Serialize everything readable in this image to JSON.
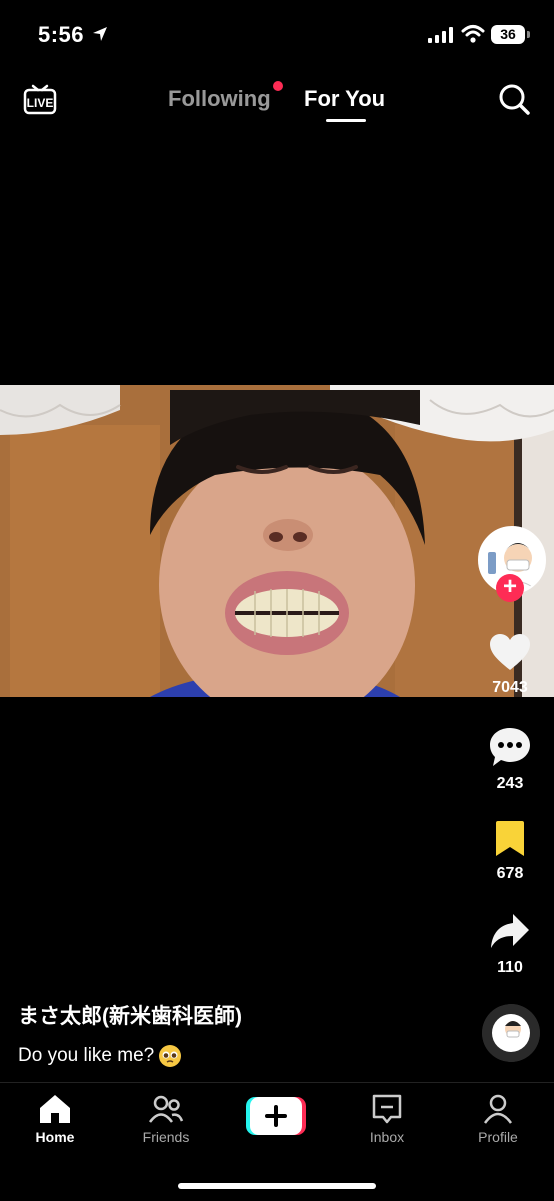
{
  "status_bar": {
    "time": "5:56",
    "battery": "36"
  },
  "top_nav": {
    "live_label": "LIVE",
    "tab_following": "Following",
    "tab_for_you": "For You",
    "active_tab": "For You"
  },
  "video": {
    "creator_name": "まさ太郎(新米歯科医師)",
    "caption": "Do you like me?"
  },
  "actions": {
    "likes": "7043",
    "comments": "243",
    "saves": "678",
    "shares": "110"
  },
  "bottom_nav": {
    "home": "Home",
    "friends": "Friends",
    "inbox": "Inbox",
    "profile": "Profile",
    "active": "Home"
  },
  "colors": {
    "accent": "#fe2c55",
    "bookmark": "#f9d338",
    "background": "#000000"
  },
  "icons": [
    "location-arrow-icon",
    "signal-icon",
    "wifi-icon",
    "battery-icon",
    "live-icon",
    "search-icon",
    "heart-icon",
    "comment-icon",
    "bookmark-icon",
    "share-icon",
    "home-icon",
    "friends-icon",
    "create-plus-icon",
    "inbox-icon",
    "profile-icon"
  ]
}
